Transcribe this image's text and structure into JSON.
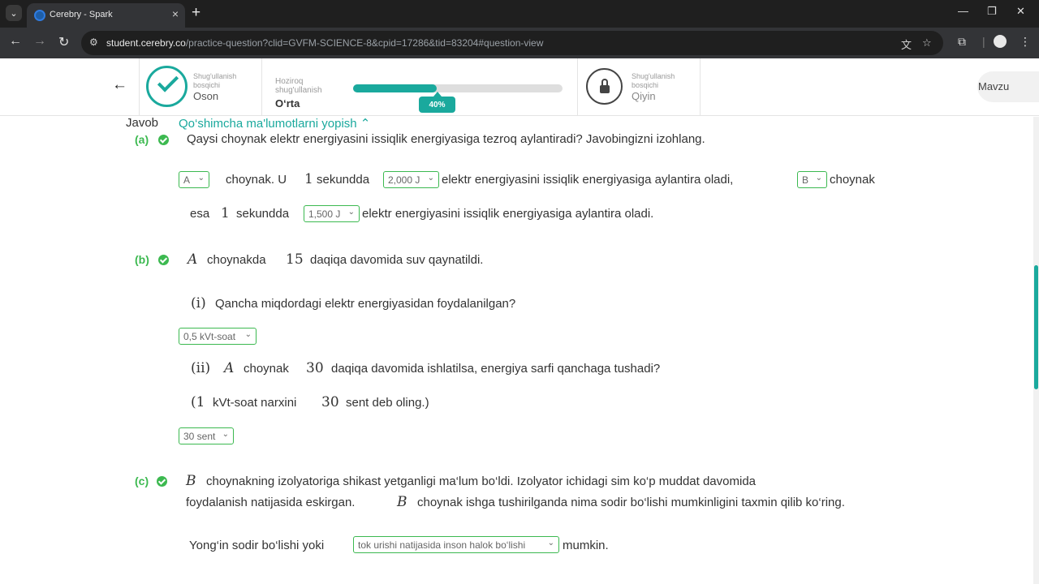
{
  "browser": {
    "tab_title": "Cerebry - Spark",
    "url_host": "student.cerebry.co",
    "url_path": "/practice-question?clid=GVFM-SCIENCE-8&cpid=17286&tid=83204#question-view"
  },
  "progress": {
    "easy_caption": "Shug'ullanish bosqichi",
    "easy_level": "Oson",
    "current_caption": "Hoziroq shug'ullanish",
    "current_level": "O‘rta",
    "percent": 40,
    "percent_label": "40%",
    "hard_caption": "Shug'ullanish bosqichi",
    "hard_level": "Qiyin",
    "topic_button": "Mavzu"
  },
  "answer": {
    "heading": "Javob",
    "toggle_label": "Qo‘shimcha ma'lumotlarni yopish"
  },
  "part_a": {
    "label": "(a)",
    "question": "Qaysi choynak elektr energiyasini issiqlik energiyasiga tezroq aylantiradi? Javobingizni izohlang.",
    "select_kettle1": "A",
    "text1": "choynak. U",
    "num1": "1",
    "text2": "sekundda",
    "select_energy1": "2,000 J",
    "text3": "elektr energiyasini issiqlik energiyasiga aylantira oladi,",
    "select_kettle2": "B",
    "text4": "choynak",
    "text5": "esa",
    "num2": "1",
    "text6": "sekundda",
    "select_energy2": "1,500 J",
    "text7": "elektr energiyasini issiqlik energiyasiga aylantira oladi."
  },
  "part_b": {
    "label": "(b)",
    "var_a": "A",
    "text1": "choynakda",
    "num_minutes": "15",
    "text2": "daqiqa davomida suv qaynatildi.",
    "sub_i": "(i)",
    "q_i": "Qancha miqdordagi elektr energiyasidan foydalanilgan?",
    "select_i": "0,5 kVt-soat",
    "sub_ii": "(ii)",
    "var_a2": "A",
    "text3": "choynak",
    "num_minutes2": "30",
    "text4": "daqiqa davomida ishlatilsa, energiya sarfi qanchaga tushadi?",
    "paren_open": "(1",
    "text5": "kVt-soat narxini",
    "num_cents": "30",
    "text6": "sent deb oling.)",
    "select_ii": "30 sent"
  },
  "part_c": {
    "label": "(c)",
    "var_b": "B",
    "text1": "choynakning izolyatoriga shikast yetganligi ma‘lum bo‘ldi. Izolyator ichidagi sim ko‘p muddat davomida",
    "text2": "foydalanish natijasida eskirgan.",
    "var_b2": "B",
    "text3": "choynak ishga tushirilganda nima sodir bo‘lishi mumkinligini taxmin qilib ko‘ring.",
    "text4": "Yong‘in sodir bo‘lishi yoki",
    "select": "tok urishi natijasida inson halok bo‘lishi",
    "text5": "mumkin."
  }
}
